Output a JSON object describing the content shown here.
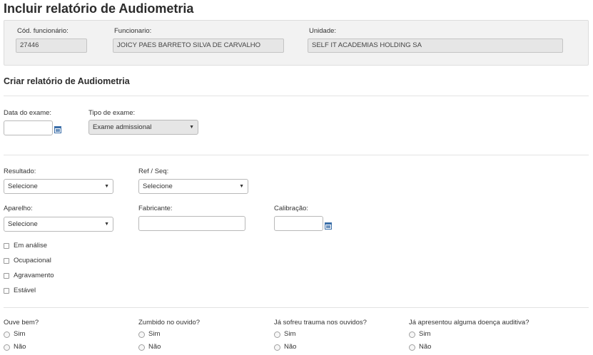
{
  "page": {
    "title": "Incluir relatório de Audiometria",
    "section_title": "Criar relatório de Audiometria"
  },
  "employee": {
    "cod_label": "Cód. funcionário:",
    "cod_value": "27446",
    "name_label": "Funcionario:",
    "name_value": "JOICY PAES BARRETO SILVA DE CARVALHO",
    "unit_label": "Unidade:",
    "unit_value": "SELF IT ACADEMIAS HOLDING SA"
  },
  "exam": {
    "date_label": "Data do exame:",
    "date_value": "",
    "type_label": "Tipo de exame:",
    "type_value": "Exame admissional"
  },
  "fields": {
    "resultado_label": "Resultado:",
    "resultado_value": "Selecione",
    "refseq_label": "Ref / Seq:",
    "refseq_value": "Selecione",
    "aparelho_label": "Aparelho:",
    "aparelho_value": "Selecione",
    "fabricante_label": "Fabricante:",
    "fabricante_value": "",
    "calibracao_label": "Calibração:",
    "calibracao_value": ""
  },
  "checkboxes": [
    {
      "label": "Em análise",
      "checked": false
    },
    {
      "label": "Ocupacional",
      "checked": false
    },
    {
      "label": "Agravamento",
      "checked": false
    },
    {
      "label": "Estável",
      "checked": false
    }
  ],
  "questions": [
    {
      "label": "Ouve bem?",
      "yes": "Sim",
      "no": "Não"
    },
    {
      "label": "Zumbido no ouvido?",
      "yes": "Sim",
      "no": "Não"
    },
    {
      "label": "Já sofreu trauma nos ouvidos?",
      "yes": "Sim",
      "no": "Não"
    },
    {
      "label": "Já apresentou alguma doença auditiva?",
      "yes": "Sim",
      "no": "Não"
    }
  ],
  "icons": {
    "calendar": "calendar-icon",
    "caret": "▼"
  },
  "colors": {
    "accent": "#3b6ea8",
    "panel_bg": "#f2f2f2",
    "readonly_bg": "#e6e6e6"
  }
}
